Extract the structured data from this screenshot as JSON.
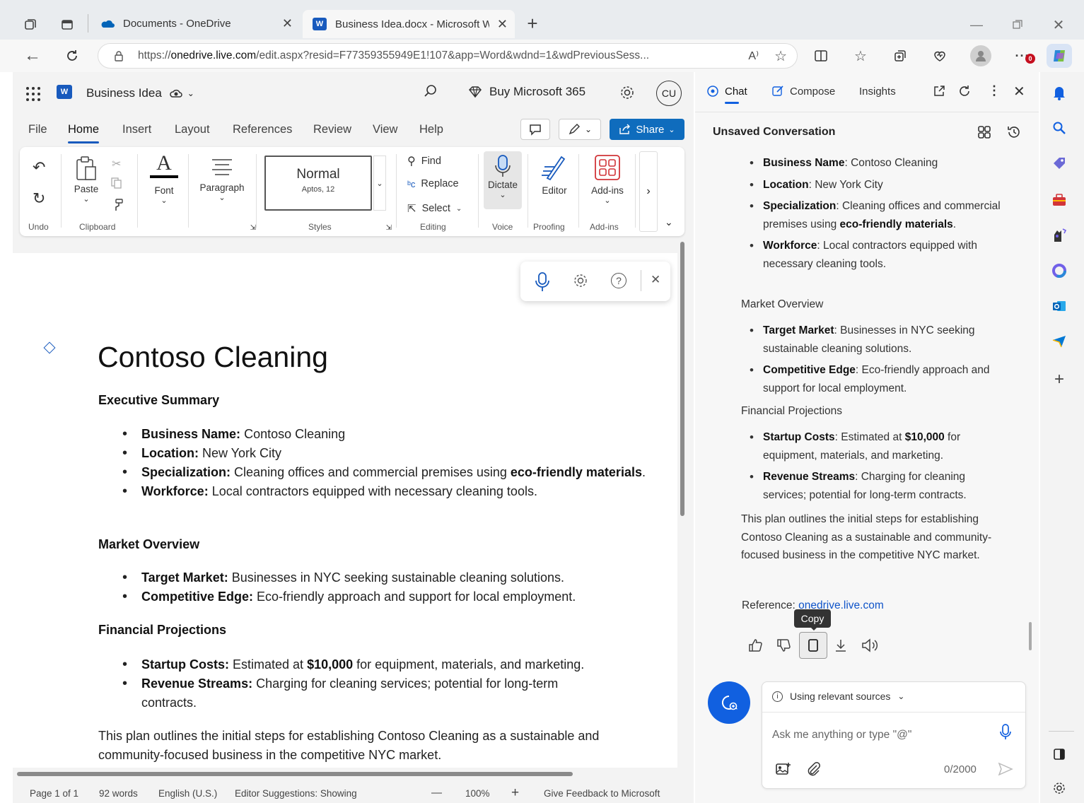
{
  "browser": {
    "tabs": [
      {
        "title": "Documents - OneDrive"
      },
      {
        "title": "Business Idea.docx - Microsoft W"
      }
    ],
    "url_prefix": "https://",
    "url_host": "onedrive.live.com",
    "url_rest": "/edit.aspx?resid=F77359355949E1!107&app=Word&wdnd=1&wdPreviousSess...",
    "reader_label": "A⁾",
    "notification_badge": "0"
  },
  "word": {
    "doc_name": "Business Idea",
    "search_icon": "search-icon",
    "buy_label": "Buy Microsoft 365",
    "avatar_initials": "CU",
    "menus": [
      "File",
      "Home",
      "Insert",
      "Layout",
      "References",
      "Review",
      "View",
      "Help"
    ],
    "share_label": "Share",
    "ribbon": {
      "undo_label": "Undo",
      "paste_label": "Paste",
      "clipboard_label": "Clipboard",
      "font_label": "Font",
      "paragraph_label": "Paragraph",
      "style_name": "Normal",
      "style_font": "Aptos, 12",
      "styles_label": "Styles",
      "find_label": "Find",
      "replace_label": "Replace",
      "select_label": "Select",
      "editing_label": "Editing",
      "dictate_label": "Dictate",
      "voice_label": "Voice",
      "editor_label": "Editor",
      "proofing_label": "Proofing",
      "addins_label": "Add-ins",
      "addins_group_label": "Add-ins"
    },
    "document": {
      "title": "Contoso Cleaning",
      "exec_heading": "Executive Summary",
      "exec_items": [
        {
          "key": "Business Name:",
          "text": " Contoso Cleaning"
        },
        {
          "key": "Location:",
          "text": " New York City"
        },
        {
          "key": "Specialization:",
          "text": " Cleaning offices and commercial premises using ",
          "bold_tail": "eco-friendly materials",
          "tail_end": "."
        },
        {
          "key": "Workforce:",
          "text": " Local contractors equipped with necessary cleaning tools."
        }
      ],
      "market_heading": "Market Overview",
      "market_items": [
        {
          "key": "Target Market:",
          "text": " Businesses in NYC seeking sustainable cleaning solutions."
        },
        {
          "key": "Competitive Edge:",
          "text": " Eco-friendly approach and support for local employment."
        }
      ],
      "fin_heading": "Financial Projections",
      "fin_items": [
        {
          "key": "Startup Costs:",
          "text": " Estimated at ",
          "bold_mid": "$10,000",
          "text2": " for equipment, materials, and marketing."
        },
        {
          "key": "Revenue Streams:",
          "text": " Charging for cleaning services; potential for long-term contracts."
        }
      ],
      "closing": "This plan outlines the initial steps for establishing Contoso Cleaning as a sustainable and community-focused business in the competitive NYC market."
    },
    "status": {
      "page": "Page 1 of 1",
      "words": "92 words",
      "language": "English (U.S.)",
      "editor": "Editor Suggestions: Showing",
      "minus": "—",
      "zoom": "100%",
      "plus": "+",
      "feedback": "Give Feedback to Microsoft"
    }
  },
  "copilot": {
    "tabs": [
      "Chat",
      "Compose",
      "Insights"
    ],
    "conversation_title": "Unsaved Conversation",
    "exec_items": [
      {
        "key": "Business Name",
        "text": ": Contoso Cleaning"
      },
      {
        "key": "Location",
        "text": ": New York City"
      },
      {
        "key": "Specialization",
        "text": ": Cleaning offices and commercial premises using ",
        "bold_tail": "eco-friendly materials",
        "tail_end": "."
      },
      {
        "key": "Workforce",
        "text": ": Local contractors equipped with necessary cleaning tools."
      }
    ],
    "market_heading": "Market Overview",
    "market_items": [
      {
        "key": "Target Market",
        "text": ": Businesses in NYC seeking sustainable cleaning solutions."
      },
      {
        "key": "Competitive Edge",
        "text": ": Eco-friendly approach and support for local employment."
      }
    ],
    "fin_heading": "Financial Projections",
    "fin_items": [
      {
        "key": "Startup Costs",
        "text": ": Estimated at ",
        "bold_mid": "$10,000",
        "text2": " for equipment, materials, and marketing."
      },
      {
        "key": "Revenue Streams",
        "text": ": Charging for cleaning services; potential for long-term contracts."
      }
    ],
    "closing": "This plan outlines the initial steps for establishing Contoso Cleaning as a sustainable and community-focused business in the competitive NYC market.",
    "reference_label": "Reference: ",
    "reference_link": "onedrive.live.com",
    "tooltip": "Copy",
    "sources_label": "Using relevant sources",
    "input_placeholder": "Ask me anything or type \"@\"",
    "char_count": "0/2000"
  },
  "colors": {
    "word_blue": "#185abd",
    "share_blue": "#0f6cbd",
    "copilot_blue": "#1160e0",
    "link_blue": "#0f54c9"
  }
}
